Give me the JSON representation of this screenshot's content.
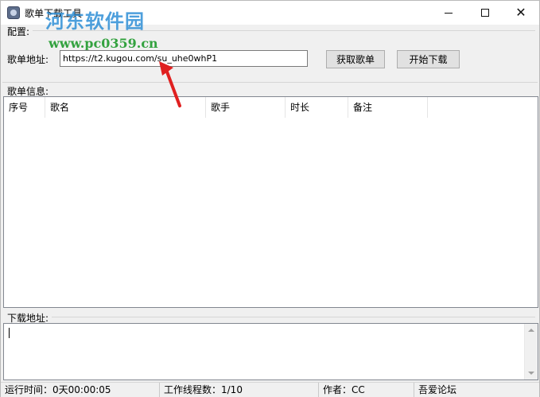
{
  "window": {
    "title": "歌单下载工具"
  },
  "watermark": {
    "brand": "河东软件园",
    "url": "www.pc0359.cn"
  },
  "config": {
    "section_label": "配置:",
    "url_label": "歌单地址:",
    "url_value": "https://t2.kugou.com/su_uhe0whP1",
    "fetch_button": "获取歌单",
    "start_button": "开始下载"
  },
  "playlist": {
    "section_label": "歌单信息:",
    "columns": [
      "序号",
      "歌名",
      "歌手",
      "时长",
      "备注"
    ],
    "rows": []
  },
  "download": {
    "section_label": "下载地址:",
    "value": ""
  },
  "status": {
    "runtime": "运行时间：0天00:00:05",
    "threads": "工作线程数：1/10",
    "author": "作者：CC",
    "forum": "吾爱论坛"
  },
  "colors": {
    "annotation_arrow": "#e02020",
    "watermark_brand": "#2f8fd6",
    "watermark_url": "#1f9a2c"
  }
}
